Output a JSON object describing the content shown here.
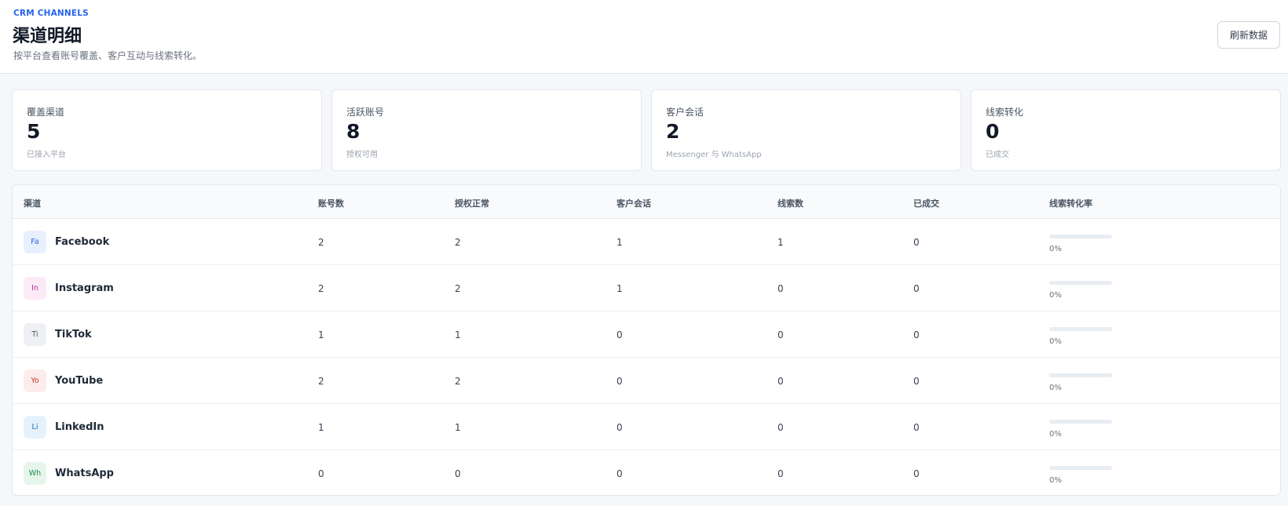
{
  "header": {
    "eyebrow": "CRM CHANNELS",
    "title": "渠道明细",
    "subtitle": "按平台查看账号覆盖、客户互动与线索转化。",
    "refresh_label": "刷新数据"
  },
  "cards": [
    {
      "label": "覆盖渠道",
      "value": "5",
      "note": "已接入平台"
    },
    {
      "label": "活跃账号",
      "value": "8",
      "note": "授权可用"
    },
    {
      "label": "客户会话",
      "value": "2",
      "note": "Messenger 与 WhatsApp"
    },
    {
      "label": "线索转化",
      "value": "0",
      "note": "已成交"
    }
  ],
  "table": {
    "columns": [
      "渠道",
      "账号数",
      "授权正常",
      "客户会话",
      "线索数",
      "已成交",
      "线索转化率"
    ],
    "rows": [
      {
        "badge": "Fa",
        "name": "Facebook",
        "accounts": "2",
        "authorized": "2",
        "conversations": "1",
        "leads": "1",
        "closed": "0",
        "rate": "0%",
        "rate_value": 0,
        "badge_bg": "#e8f0fe",
        "badge_fg": "#2563eb"
      },
      {
        "badge": "In",
        "name": "Instagram",
        "accounts": "2",
        "authorized": "2",
        "conversations": "1",
        "leads": "0",
        "closed": "0",
        "rate": "0%",
        "rate_value": 0,
        "badge_bg": "#fcebf7",
        "badge_fg": "#b13a8c"
      },
      {
        "badge": "Ti",
        "name": "TikTok",
        "accounts": "1",
        "authorized": "1",
        "conversations": "0",
        "leads": "0",
        "closed": "0",
        "rate": "0%",
        "rate_value": 0,
        "badge_bg": "#eef0f3",
        "badge_fg": "#4b5563"
      },
      {
        "badge": "Yo",
        "name": "YouTube",
        "accounts": "2",
        "authorized": "2",
        "conversations": "0",
        "leads": "0",
        "closed": "0",
        "rate": "0%",
        "rate_value": 0,
        "badge_bg": "#fdecec",
        "badge_fg": "#c0392b"
      },
      {
        "badge": "Li",
        "name": "LinkedIn",
        "accounts": "1",
        "authorized": "1",
        "conversations": "0",
        "leads": "0",
        "closed": "0",
        "rate": "0%",
        "rate_value": 0,
        "badge_bg": "#e6f2fb",
        "badge_fg": "#1f6fb2"
      },
      {
        "badge": "Wh",
        "name": "WhatsApp",
        "accounts": "0",
        "authorized": "0",
        "conversations": "0",
        "leads": "0",
        "closed": "0",
        "rate": "0%",
        "rate_value": 0,
        "badge_bg": "#e6f6ec",
        "badge_fg": "#1e8a4c"
      }
    ]
  }
}
